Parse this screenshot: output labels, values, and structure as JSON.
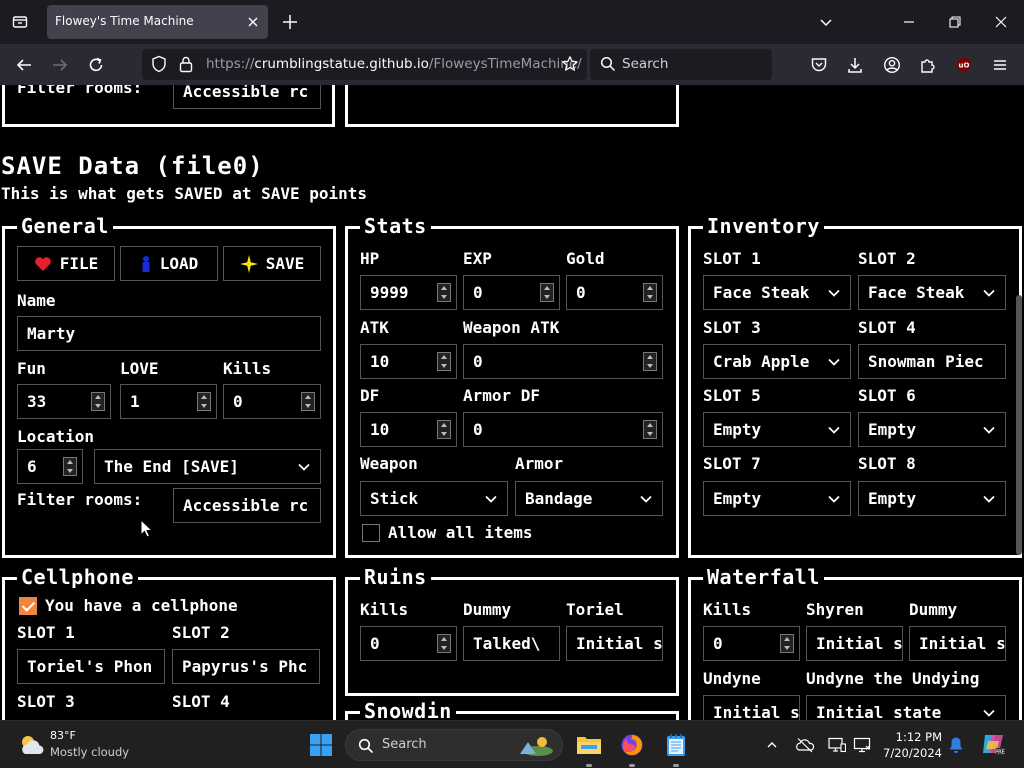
{
  "browser": {
    "tab_title": "Flowey's Time Machine",
    "url_scheme": "https://",
    "url_host": "crumblingstatue.github.io",
    "url_path": "/FloweysTimeMachine/",
    "search_placeholder": "Search"
  },
  "top": {
    "filter_label": "Filter rooms:",
    "filter_value": "Accessible rc"
  },
  "save": {
    "heading": "SAVE Data (file0)",
    "subheading": "This is what gets SAVED at SAVE points"
  },
  "general": {
    "title": "General",
    "buttons": {
      "file": "FILE",
      "load": "LOAD",
      "save": "SAVE"
    },
    "name_label": "Name",
    "name_value": "Marty",
    "fun_label": "Fun",
    "fun_value": "33",
    "love_label": "LOVE",
    "love_value": "1",
    "kills_label": "Kills",
    "kills_value": "0",
    "location_label": "Location",
    "location_num": "6",
    "location_value": "The End [SAVE]",
    "filter_label": "Filter rooms:",
    "filter_value": "Accessible rc"
  },
  "stats": {
    "title": "Stats",
    "hp_label": "HP",
    "hp_value": "9999",
    "exp_label": "EXP",
    "exp_value": "0",
    "gold_label": "Gold",
    "gold_value": "0",
    "atk_label": "ATK",
    "atk_value": "10",
    "watk_label": "Weapon ATK",
    "watk_value": "0",
    "df_label": "DF",
    "df_value": "10",
    "adf_label": "Armor DF",
    "adf_value": "0",
    "weapon_label": "Weapon",
    "weapon_value": "Stick",
    "armor_label": "Armor",
    "armor_value": "Bandage",
    "allow_label": "Allow all items"
  },
  "inventory": {
    "title": "Inventory",
    "slots": [
      {
        "label": "SLOT 1",
        "value": "Face Steak"
      },
      {
        "label": "SLOT 2",
        "value": "Face Steak"
      },
      {
        "label": "SLOT 3",
        "value": "Crab Apple"
      },
      {
        "label": "SLOT 4",
        "value": "Snowman Piec"
      },
      {
        "label": "SLOT 5",
        "value": "Empty"
      },
      {
        "label": "SLOT 6",
        "value": "Empty"
      },
      {
        "label": "SLOT 7",
        "value": "Empty"
      },
      {
        "label": "SLOT 8",
        "value": "Empty"
      }
    ]
  },
  "cellphone": {
    "title": "Cellphone",
    "has_label": "You have a cellphone",
    "slots": [
      {
        "label": "SLOT 1",
        "value": "Toriel's Phon"
      },
      {
        "label": "SLOT 2",
        "value": "Papyrus's Phc"
      },
      {
        "label": "SLOT 3",
        "value": ""
      },
      {
        "label": "SLOT 4",
        "value": ""
      }
    ]
  },
  "ruins": {
    "title": "Ruins",
    "kills_label": "Kills",
    "kills_value": "0",
    "dummy_label": "Dummy",
    "dummy_value": "Talked\\",
    "toriel_label": "Toriel",
    "toriel_value": "Initial s"
  },
  "snowdin": {
    "title": "Snowdin"
  },
  "waterfall": {
    "title": "Waterfall",
    "kills_label": "Kills",
    "kills_value": "0",
    "shyren_label": "Shyren",
    "shyren_value": "Initial s",
    "dummy_label": "Dummy",
    "dummy_value": "Initial s",
    "undyne_label": "Undyne",
    "undyne_value": "Initial s",
    "undying_label": "Undyne the Undying",
    "undying_value": "Initial state"
  },
  "taskbar": {
    "temp": "83°F",
    "condition": "Mostly cloudy",
    "search_placeholder": "Search",
    "time": "1:12 PM",
    "date": "7/20/2024"
  },
  "colors": {
    "heart": "#e8202a",
    "checkbox": "#f0853d",
    "chrome_dark": "#1c1b22",
    "chrome": "#2b2a33"
  }
}
